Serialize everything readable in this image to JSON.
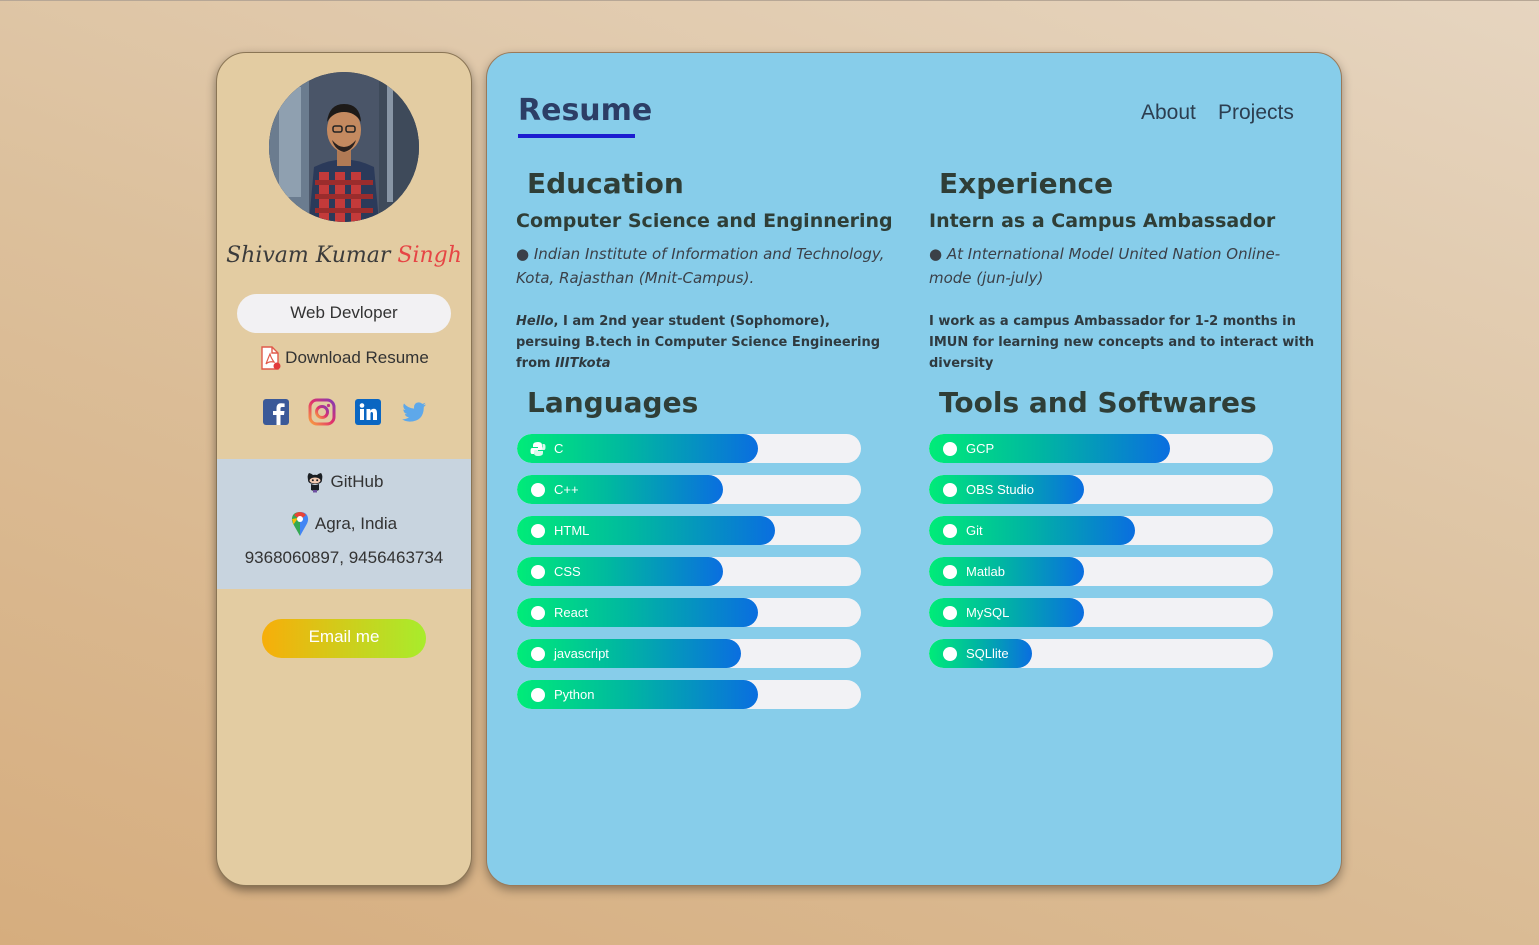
{
  "sidebar": {
    "name_first": "Shivam Kumar",
    "name_last": "Singh",
    "role": "Web Devloper",
    "download_label": "Download Resume",
    "socials": [
      "facebook-icon",
      "instagram-icon",
      "linkedin-icon",
      "twitter-icon"
    ],
    "github_label": "GitHub",
    "location": "Agra, India",
    "phone": "9368060897, 9456463734",
    "email_label": "Email me"
  },
  "header": {
    "title": "Resume",
    "nav": [
      "About",
      "Projects"
    ]
  },
  "education": {
    "heading": "Education",
    "subheading": "Computer Science and Enginnering",
    "detail": "● Indian Institute of Information and Technology, Kota, Rajasthan (Mnit-Campus).",
    "bio_hello": "Hello",
    "bio_mid": ", I am 2nd year student (Sophomore), persuing B.tech in Computer Science Engineering from ",
    "bio_end": "IIITkota"
  },
  "experience": {
    "heading": "Experience",
    "subheading": "Intern as a Campus Ambassador",
    "detail": "● At International Model United Nation Online-mode (jun-july)",
    "bio": "I work as a campus Ambassador for 1-2 months in IMUN for learning new concepts and to interact with diversity"
  },
  "languages": {
    "heading": "Languages",
    "items": [
      {
        "label": "C",
        "level": 0.7
      },
      {
        "label": "C++",
        "level": 0.6
      },
      {
        "label": "HTML",
        "level": 0.75
      },
      {
        "label": "CSS",
        "level": 0.6
      },
      {
        "label": "React",
        "level": 0.7
      },
      {
        "label": "javascript",
        "level": 0.65
      },
      {
        "label": "Python",
        "level": 0.7
      }
    ]
  },
  "tools": {
    "heading": "Tools and Softwares",
    "items": [
      {
        "label": "GCP",
        "level": 0.7
      },
      {
        "label": "OBS Studio",
        "level": 0.45
      },
      {
        "label": "Git",
        "level": 0.6
      },
      {
        "label": "Matlab",
        "level": 0.45
      },
      {
        "label": "MySQL",
        "level": 0.45
      },
      {
        "label": "SQLlite",
        "level": 0.3
      }
    ]
  },
  "colors": {
    "accent": "#1c1cd0",
    "main_bg": "#87cdea",
    "sidebar_bg": "#e3cca2",
    "name_accent": "#e64545"
  }
}
